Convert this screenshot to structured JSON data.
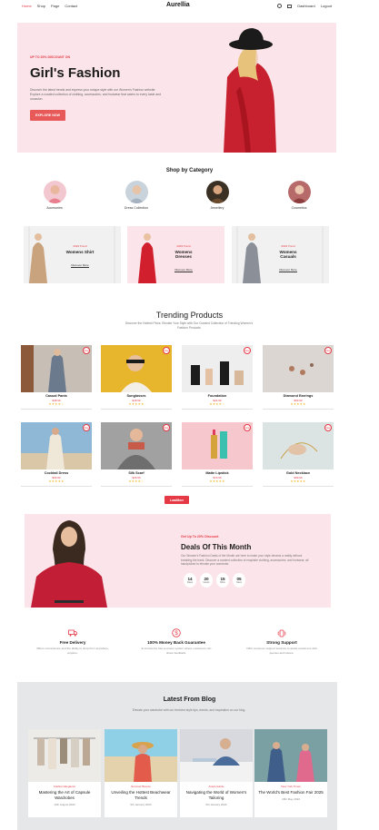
{
  "nav": {
    "links": [
      "Home",
      "Shop",
      "Page",
      "Contact"
    ],
    "brand": "Aurellia",
    "dashboard": "Dashboard",
    "logout": "Logout"
  },
  "hero": {
    "tag": "UP TO 20% DISCOUNT ON",
    "title": "Girl's Fashion",
    "description": "Discover the latest trends and express your unique style with our Women's Fashion website. Explore a curated collection of clothing, accessories, and footwear that caters to every taste and occasion.",
    "button": "EXPLORE NOW"
  },
  "categories": {
    "title": "Shop by Category",
    "items": [
      "Accesories",
      "Dress Collection",
      "Jewellery",
      "Cosmetics"
    ]
  },
  "promos": [
    {
      "tag": "2023 Trend",
      "title": "Womens Shirt",
      "link": "Discover More"
    },
    {
      "tag": "2023 Trend",
      "title": "Womens Dresses",
      "link": "Discover More"
    },
    {
      "tag": "2023 Trend",
      "title": "Womens Casuals",
      "link": "Discover More"
    }
  ],
  "trending": {
    "title": "Trending Products",
    "subtitle": "Discover the Hottest Picks: Elevate Your Style with Our Curated Collection of Trending Women's Fashion Products",
    "badge": "New",
    "products": [
      {
        "name": "Casual Pants",
        "price": "$38.99"
      },
      {
        "name": "Sunglasses",
        "price": "$18.99"
      },
      {
        "name": "Foundation",
        "price": "$24.99"
      },
      {
        "name": "Diamond Earrings",
        "price": "$99.99"
      },
      {
        "name": "Cocktail Dress",
        "price": "$69.99"
      },
      {
        "name": "Silk Scarf",
        "price": "$29.99"
      },
      {
        "name": "Matte Lipstick",
        "price": "$19.99"
      },
      {
        "name": "Gold Necklace",
        "price": "$99.99"
      }
    ],
    "load_more": "LoadMore"
  },
  "deals": {
    "tag": "Get Up To 20% Discount",
    "title": "Deals Of This Month",
    "description": "Our Women's Fashion Deals of the Month are here to make your style dreams a reality without breaking the bank. Discover a curated collection of exquisite clothing, accessories, and footwear, all handpicked to elevate your wardrobe.",
    "countdown": [
      {
        "value": "14",
        "label": "Days"
      },
      {
        "value": "20",
        "label": "Hours"
      },
      {
        "value": "15",
        "label": "Mins"
      },
      {
        "value": "05",
        "label": "Secs"
      }
    ]
  },
  "features": [
    {
      "icon": "truck-icon",
      "title": "Free Delivery",
      "desc": "Offers convenience and the ability to shop from anywhere, anytime."
    },
    {
      "icon": "dollar-icon",
      "title": "100% Money Back Guarantee",
      "desc": "E-commerce has a review system where customers can share feedback."
    },
    {
      "icon": "headset-icon",
      "title": "Strong Support",
      "desc": "Offer customer support services to assist customers with queries and issues."
    }
  ],
  "blog": {
    "title": "Latest From Blog",
    "subtitle": "Elevate your wardrobe with our freshest style tips, trends, and inspiration on our blog.",
    "posts": [
      {
        "category": "Fashion Elegance",
        "title": "Mastering the Art of Capsule Wardrobes",
        "date": "12th August 2022"
      },
      {
        "category": "Summer Breeze",
        "title": "Unveiling the Hottest Beachwear Trends",
        "date": "9th January 2023"
      },
      {
        "category": "Avant-Garde",
        "title": "Navigating the World of Women's Tailoring",
        "date": "5th January 2023"
      },
      {
        "category": "New York Times",
        "title": "The World's Best Fashion Fair 2025",
        "date": "15th May 2023"
      }
    ]
  },
  "colors": {
    "accent": "#e53945",
    "hero_bg": "#fbe5ea",
    "blog_bg": "#e6e7e9",
    "star": "#f1b92e"
  }
}
